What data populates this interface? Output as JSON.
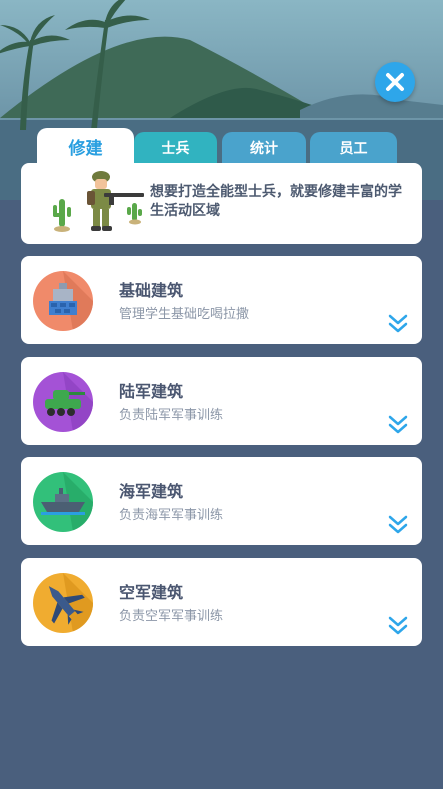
{
  "tabs": [
    {
      "label": "修建",
      "active": true
    },
    {
      "label": "士兵",
      "active": false
    },
    {
      "label": "统计",
      "active": false
    },
    {
      "label": "员工",
      "active": false
    }
  ],
  "intro": {
    "text": "想要打造全能型士兵，就要修建丰富的学生活动区域"
  },
  "buildings": [
    {
      "title": "基础建筑",
      "desc": "管理学生基础吃喝拉撒",
      "icon": "barracks-icon",
      "color": "#f08a6a"
    },
    {
      "title": "陆军建筑",
      "desc": "负责陆军军事训练",
      "icon": "tank-icon",
      "color": "#a452d6"
    },
    {
      "title": "海军建筑",
      "desc": "负责海军军事训练",
      "icon": "warship-icon",
      "color": "#32c07a"
    },
    {
      "title": "空军建筑",
      "desc": "负责空军军事训练",
      "icon": "jet-icon",
      "color": "#f0ac30"
    }
  ],
  "colors": {
    "accent": "#2a9fe0",
    "close": "#2ea6ea",
    "background": "#4a5f7d"
  }
}
